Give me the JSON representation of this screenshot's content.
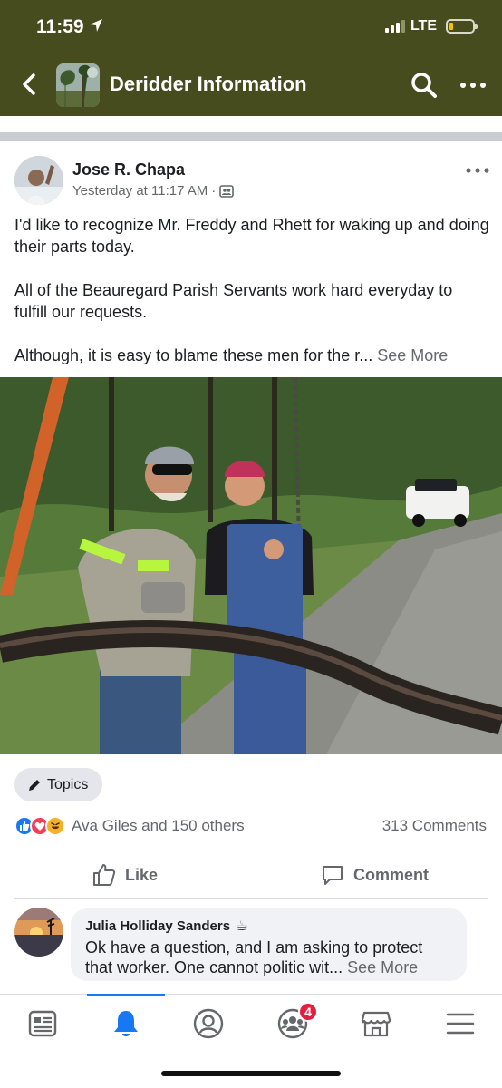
{
  "status_bar": {
    "time": "11:59",
    "network": "LTE"
  },
  "header": {
    "title": "Deridder Information"
  },
  "post": {
    "author": "Jose R. Chapa",
    "timestamp": "Yesterday at 11:17 AM",
    "privacy_icon": "group-members-icon",
    "text_p1": "I'd like to recognize Mr. Freddy and Rhett for waking up and doing their parts today.",
    "text_p2": "All of the Beauregard Parish Servants work hard everyday to fulfill our requests.",
    "text_p3": "Although, it is easy to blame these men for the r...",
    "see_more": "See More",
    "topics_label": "Topics",
    "reaction_names": "Ava Giles and 150 others",
    "comments_count": "313 Comments",
    "like_label": "Like",
    "comment_label": "Comment"
  },
  "comment": {
    "author": "Julia Holliday Sanders",
    "author_emoji": "☕",
    "text": "Ok have a question, and I am asking to protect that worker.  One cannot politic wit...",
    "see_more": "See More"
  },
  "tabbar": {
    "groups_badge": "4",
    "active_tab": "notifications"
  },
  "colors": {
    "header_bg": "#464c1e",
    "accent": "#1877f2",
    "badge": "#e41e3f"
  }
}
